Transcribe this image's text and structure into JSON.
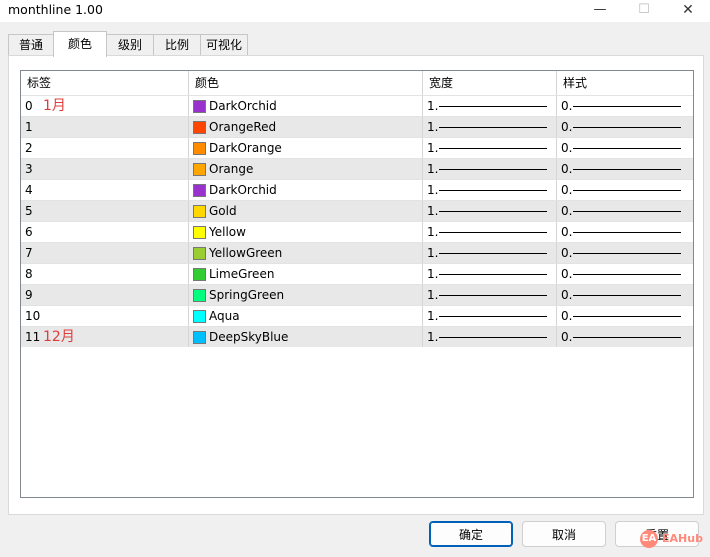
{
  "window": {
    "title": "monthline 1.00",
    "min_glyph": "—",
    "max_glyph": "☐",
    "close_glyph": "✕"
  },
  "tabs": [
    "普通",
    "颜色",
    "级别",
    "比例",
    "可视化"
  ],
  "active_tab": 1,
  "table": {
    "headers": [
      "标签",
      "颜色",
      "宽度",
      "样式"
    ],
    "rows": [
      {
        "label": "0",
        "note": "1月",
        "color_name": "DarkOrchid",
        "color": "#9932CC",
        "width": "1.",
        "style": "0."
      },
      {
        "label": "1",
        "note": "",
        "color_name": "OrangeRed",
        "color": "#FF4500",
        "width": "1.",
        "style": "0."
      },
      {
        "label": "2",
        "note": "",
        "color_name": "DarkOrange",
        "color": "#FF8C00",
        "width": "1.",
        "style": "0."
      },
      {
        "label": "3",
        "note": "",
        "color_name": "Orange",
        "color": "#FFA500",
        "width": "1.",
        "style": "0."
      },
      {
        "label": "4",
        "note": "",
        "color_name": "DarkOrchid",
        "color": "#9932CC",
        "width": "1.",
        "style": "0."
      },
      {
        "label": "5",
        "note": "",
        "color_name": "Gold",
        "color": "#FFD700",
        "width": "1.",
        "style": "0."
      },
      {
        "label": "6",
        "note": "",
        "color_name": "Yellow",
        "color": "#FFFF00",
        "width": "1.",
        "style": "0."
      },
      {
        "label": "7",
        "note": "",
        "color_name": "YellowGreen",
        "color": "#9ACD32",
        "width": "1.",
        "style": "0."
      },
      {
        "label": "8",
        "note": "",
        "color_name": "LimeGreen",
        "color": "#32CD32",
        "width": "1.",
        "style": "0."
      },
      {
        "label": "9",
        "note": "",
        "color_name": "SpringGreen",
        "color": "#00FF7F",
        "width": "1.",
        "style": "0."
      },
      {
        "label": "10",
        "note": "",
        "color_name": "Aqua",
        "color": "#00FFFF",
        "width": "1.",
        "style": "0."
      },
      {
        "label": "11",
        "note": "12月",
        "color_name": "DeepSkyBlue",
        "color": "#00BFFF",
        "width": "1.",
        "style": "0."
      }
    ]
  },
  "buttons": {
    "ok": "确定",
    "cancel": "取消",
    "reset": "重置"
  },
  "watermark": {
    "text": "EAHub",
    "icon": "EA"
  }
}
